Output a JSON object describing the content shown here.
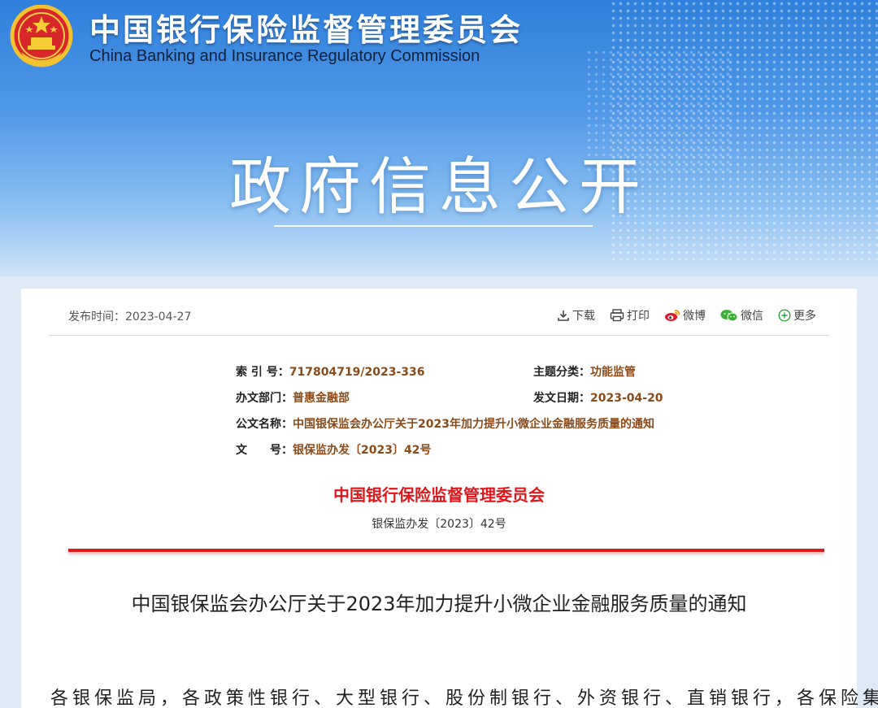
{
  "header": {
    "org_cn": "中国银行保险监督管理委员会",
    "org_en": "China Banking and Insurance Regulatory Commission",
    "section_title": "政府信息公开"
  },
  "meta": {
    "publish_label": "发布时间：",
    "publish_date": "2023-04-27",
    "tools": {
      "download": "下载",
      "print": "打印",
      "weibo": "微博",
      "wechat": "微信",
      "more": "更多"
    }
  },
  "info": {
    "index_label": "索 引 号：",
    "index_value": "717804719/2023-336",
    "topic_label": "主题分类：",
    "topic_value": "功能监管",
    "dept_label": "办文部门：",
    "dept_value": "普惠金融部",
    "date_label": "发文日期：",
    "date_value": "2023-04-20",
    "name_label": "公文名称：",
    "name_value": "中国银保监会办公厅关于2023年加力提升小微企业金融服务质量的通知",
    "docno_label": "文　　号：",
    "docno_value": "银保监办发〔2023〕42号"
  },
  "document": {
    "issuer": "中国银行保险监督管理委员会",
    "number": "银保监办发〔2023〕42号",
    "title": "中国银保监会办公厅关于2023年加力提升小微企业金融服务质量的通知",
    "body_first_line": "各银保监局，各政策性银行、大型银行、股份制银行、外资银行、直销银行，各保险集团"
  },
  "colors": {
    "accent_red": "#e31a1c",
    "info_value": "#8b4a1a",
    "banner_blue": "#2f7fdc"
  }
}
